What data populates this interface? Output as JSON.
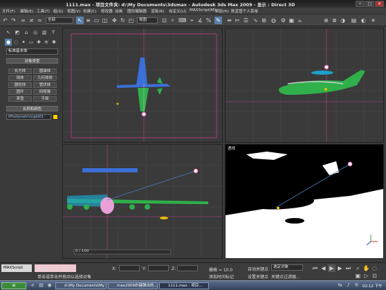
{
  "title": {
    "text": "1111.max    - 项目文件夹: d:\\My Documents\\3dsmax    - Autodesk 3ds Max  2009    - 显示 : Direct 3D"
  },
  "menu": [
    "文件(F)",
    "编辑(E)",
    "工具(T)",
    "组(G)",
    "视图(V)",
    "创建(C)",
    "修改器",
    "动画",
    "图形编辑器",
    "渲染(R)",
    "自定义(U)",
    "MAXScript(M)",
    "帮助(H)",
    "陈孟管个人菜单"
  ],
  "toolbar": {
    "selection_filter": "全部",
    "ref_coord": "视图"
  },
  "command_panel": {
    "category_dropdown": "标准基本体",
    "object_type_header": "对象类型",
    "buttons": [
      "长方体",
      "圆锥体",
      "球体",
      "几何球体",
      "圆柱体",
      "管状体",
      "圆环",
      "四棱锥",
      "茶壶",
      "平面"
    ],
    "name_color_header": "名称和颜色",
    "name_value": "tPhotometricLight01"
  },
  "viewports": {
    "top_label": "",
    "front_label": "",
    "left_label": "",
    "persp_label": "透视"
  },
  "timeline": {
    "slider": "0 / 100"
  },
  "status": {
    "maxscript": "MAXScript",
    "selected": "选择了 1 个 灯光",
    "prompt": "单击或单击并拖动以选择对象",
    "x_label": "X:",
    "y_label": "Y:",
    "z_label": "Z:",
    "grid": "栅格 = 10.0",
    "add_time_tag": "添加时间标记",
    "auto_key": "自动关键点",
    "set_key": "设置关键点",
    "selected_obj": "选定对象",
    "key_filters": "关键点过滤器..."
  },
  "taskbar": {
    "tasks": [
      "d:\\My Documents\\My ...",
      "max2009右键弹出的...",
      "1111.max - 项目..."
    ],
    "clock": "02:12 下午"
  },
  "colors": {
    "accent": "#5c7fa8",
    "name_swatch": "#ffd200",
    "grid_line": "#c0408c",
    "light_line": "#4a7fc0"
  }
}
